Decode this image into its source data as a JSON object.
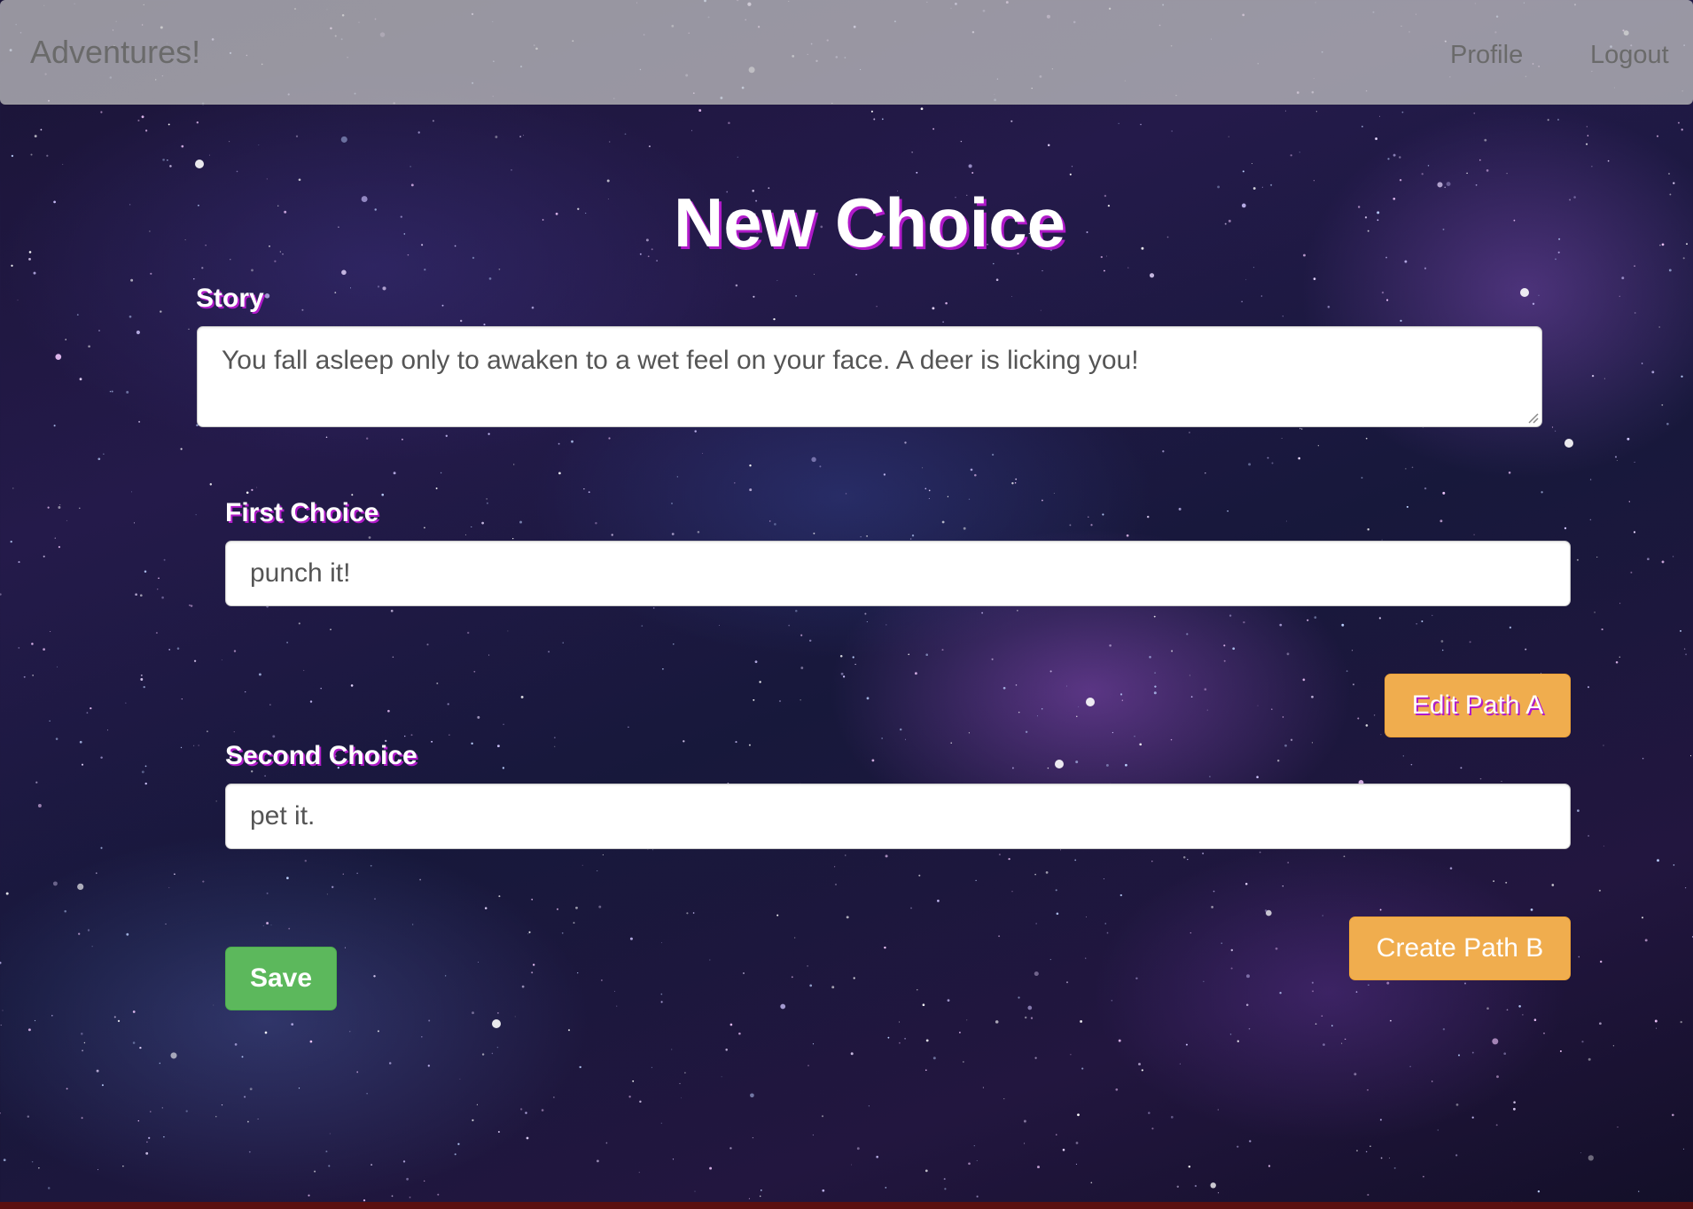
{
  "nav": {
    "brand": "Adventures!",
    "links": [
      {
        "label": "Profile"
      },
      {
        "label": "Logout"
      }
    ]
  },
  "page": {
    "title": "New Choice"
  },
  "form": {
    "story": {
      "label": "Story",
      "value": "You fall asleep only to awaken to a wet feel on your face. A deer is licking you!"
    },
    "first_choice": {
      "label": "First Choice",
      "value": "punch it!",
      "path_button": "Edit Path A"
    },
    "second_choice": {
      "label": "Second Choice",
      "value": "pet it.",
      "path_button": "Create Path B"
    },
    "save_label": "Save"
  },
  "colors": {
    "accent_shadow": "#b01ac9",
    "warning": "#f0ad4e",
    "success": "#5cb85c",
    "navbar": "#c8c8c8"
  }
}
